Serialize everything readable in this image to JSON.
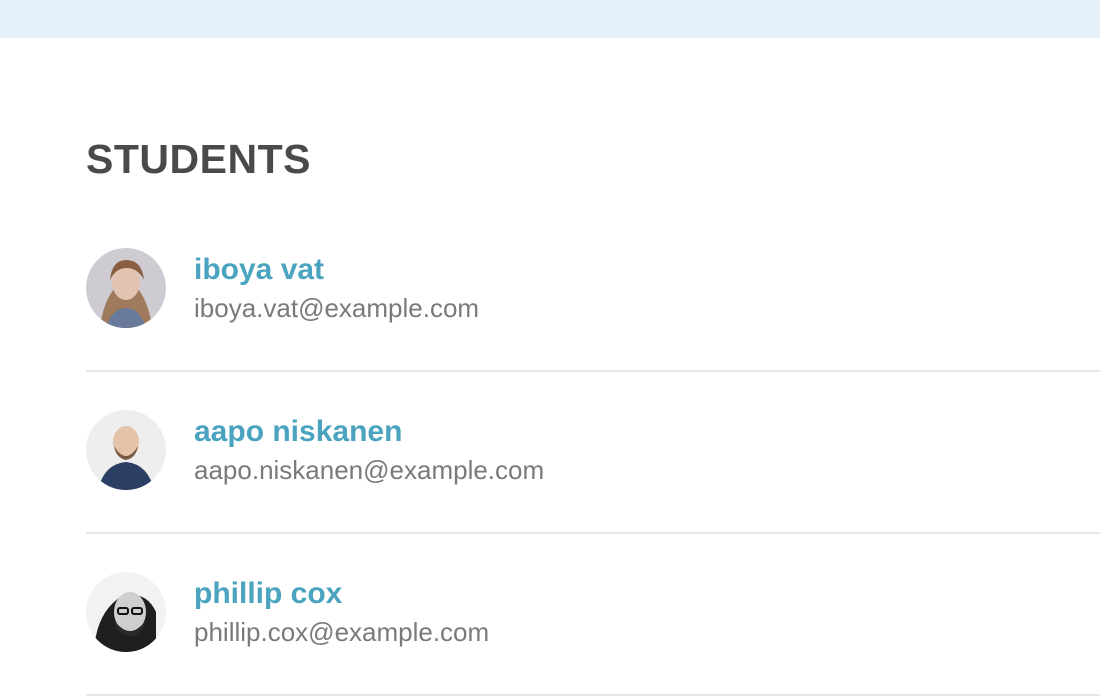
{
  "section": {
    "title": "STUDENTS"
  },
  "students": [
    {
      "name": "iboya vat",
      "email": "iboya.vat@example.com"
    },
    {
      "name": "aapo niskanen",
      "email": "aapo.niskanen@example.com"
    },
    {
      "name": "phillip cox",
      "email": "phillip.cox@example.com"
    }
  ],
  "colors": {
    "topbar": "#e3f0f7",
    "title": "#4a4a4a",
    "link": "#4aa3bf",
    "email": "#7a7a7a",
    "divider": "#e6e6e6"
  }
}
